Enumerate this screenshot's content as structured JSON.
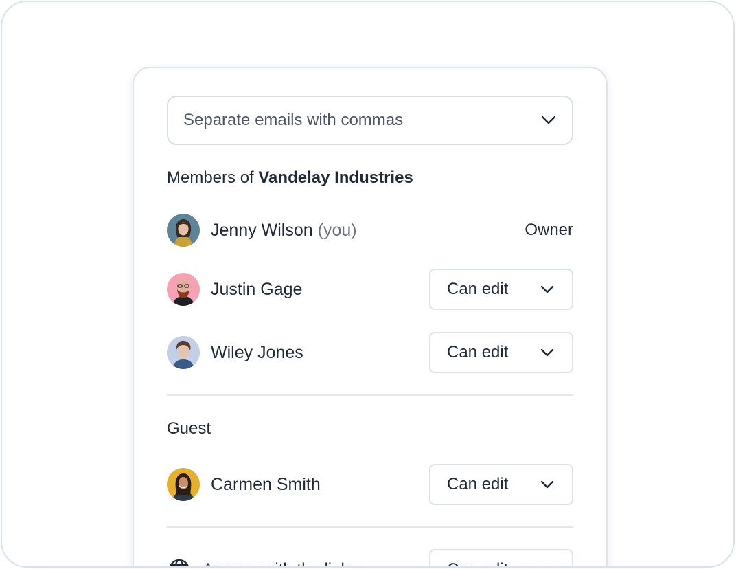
{
  "invite": {
    "placeholder": "Separate emails with commas"
  },
  "members_section": {
    "prefix": "Members of",
    "org_name": "Vandelay Industries"
  },
  "members": [
    {
      "name": "Jenny Wilson",
      "you_tag": "(you)",
      "role": "Owner"
    },
    {
      "name": "Justin Gage",
      "role": "Can edit"
    },
    {
      "name": "Wiley Jones",
      "role": "Can edit"
    }
  ],
  "guest_section": {
    "title": "Guest"
  },
  "guests": [
    {
      "name": "Carmen Smith",
      "role": "Can edit"
    }
  ],
  "link_access": {
    "scope": "Anyone with the link",
    "role": "Can edit",
    "icon": "globe-icon"
  },
  "colors": {
    "border": "#d6e2f2",
    "text": "#1f2937",
    "muted": "#6b7280"
  }
}
